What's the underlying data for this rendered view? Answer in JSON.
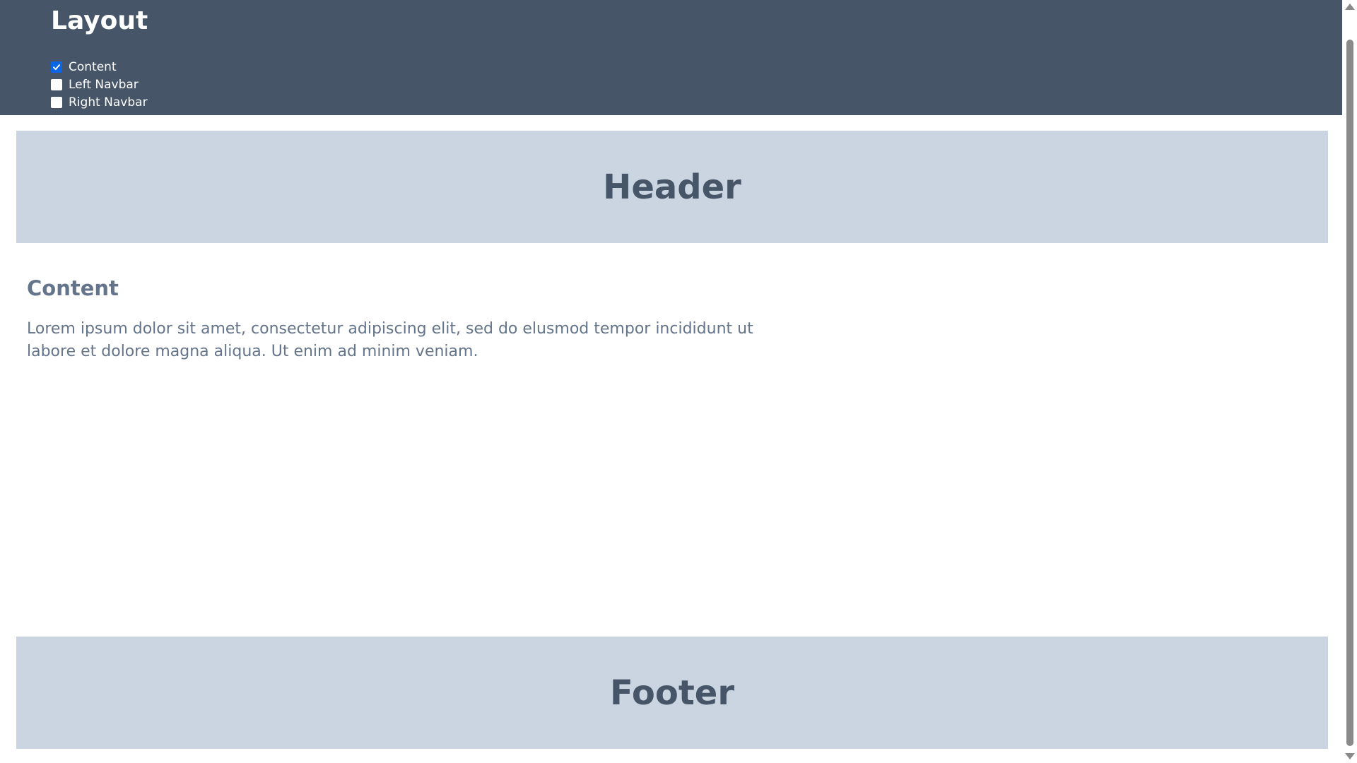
{
  "controls": {
    "title": "Layout",
    "options": [
      {
        "label": "Content",
        "checked": true
      },
      {
        "label": "Left Navbar",
        "checked": false
      },
      {
        "label": "Right Navbar",
        "checked": false
      }
    ]
  },
  "layout": {
    "header": "Header",
    "content": {
      "title": "Content",
      "body": "Lorem ipsum dolor sit amet, consectetur adipiscing elit, sed do elusmod tempor incididunt ut labore et dolore magna aliqua. Ut enim ad minim veniam."
    },
    "footer": "Footer"
  },
  "colors": {
    "control_bar": "#475569",
    "panel": "#cbd5e1",
    "heading_text": "#475569",
    "body_text": "#64748b",
    "checkbox_checked": "#0a66e4"
  }
}
